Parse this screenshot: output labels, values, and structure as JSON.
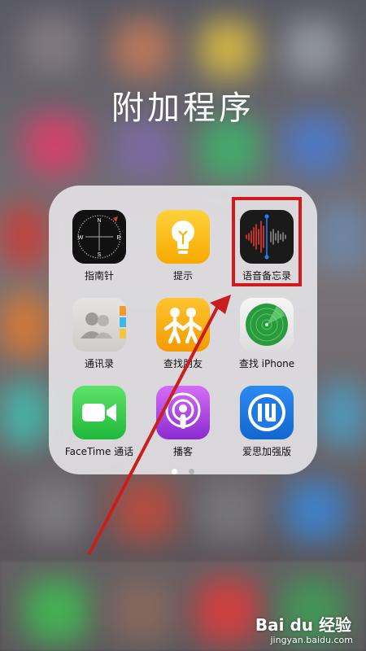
{
  "folder": {
    "title": "附加程序",
    "apps": [
      {
        "label": "指南针",
        "icon": "compass-icon"
      },
      {
        "label": "提示",
        "icon": "tips-lightbulb-icon"
      },
      {
        "label": "语音备忘录",
        "icon": "voice-memos-waveform-icon"
      },
      {
        "label": "通讯录",
        "icon": "contacts-icon"
      },
      {
        "label": "查找朋友",
        "icon": "find-friends-icon"
      },
      {
        "label": "查找 iPhone",
        "icon": "find-iphone-radar-icon"
      },
      {
        "label": "FaceTime 通话",
        "icon": "facetime-camera-icon"
      },
      {
        "label": "播客",
        "icon": "podcasts-icon"
      },
      {
        "label": "爱思加强版",
        "icon": "i4-assistant-icon"
      }
    ],
    "page_count": 2,
    "active_page": 1
  },
  "watermark": {
    "brand": "Bai du 经验",
    "url": "jingyan.baidu.com"
  },
  "colors": {
    "highlight": "#d21a1a",
    "arrow": "#c81e1e"
  }
}
